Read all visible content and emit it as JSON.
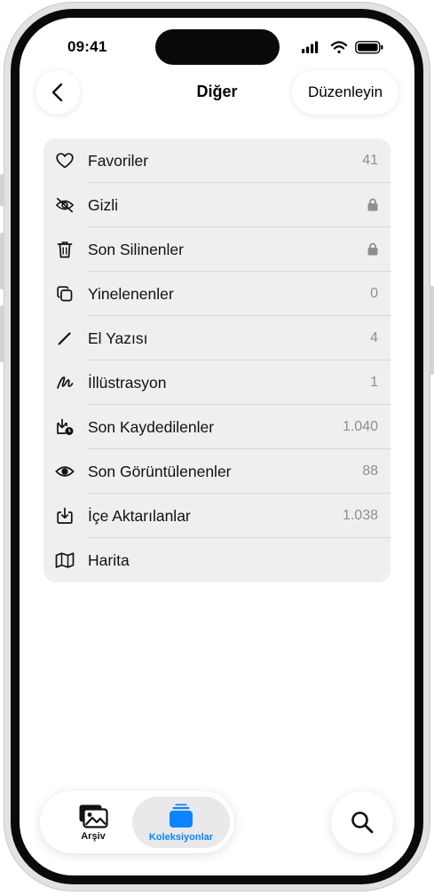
{
  "status_bar": {
    "time": "09:41"
  },
  "nav": {
    "title": "Diğer",
    "edit_label": "Düzenleyin",
    "back_icon": "chevron-left-icon"
  },
  "list": {
    "items": [
      {
        "label": "Favoriler",
        "count": "41",
        "icon": "heart-icon"
      },
      {
        "label": "Gizli",
        "count": "",
        "icon": "eye-slash-icon",
        "locked": true
      },
      {
        "label": "Son Silinenler",
        "count": "",
        "icon": "trash-icon",
        "locked": true
      },
      {
        "label": "Yinelenenler",
        "count": "0",
        "icon": "duplicate-icon"
      },
      {
        "label": "El Yazısı",
        "count": "4",
        "icon": "pencil-icon"
      },
      {
        "label": "İllüstrasyon",
        "count": "1",
        "icon": "scribble-icon"
      },
      {
        "label": "Son Kaydedilenler",
        "count": "1.040",
        "icon": "tray-download-clock-icon"
      },
      {
        "label": "Son Görüntülenenler",
        "count": "88",
        "icon": "eye-icon"
      },
      {
        "label": "İçe Aktarılanlar",
        "count": "1.038",
        "icon": "tray-download-icon"
      },
      {
        "label": "Harita",
        "count": "",
        "icon": "map-icon"
      }
    ]
  },
  "tabbar": {
    "tabs": [
      {
        "label": "Arşiv",
        "icon": "photo-library-icon",
        "selected": false
      },
      {
        "label": "Koleksiyonlar",
        "icon": "collections-icon",
        "selected": true
      }
    ],
    "search_icon": "search-icon"
  },
  "colors": {
    "accent": "#0a84ff",
    "list_background": "#efeff0",
    "secondary_text": "#8e8e93"
  }
}
